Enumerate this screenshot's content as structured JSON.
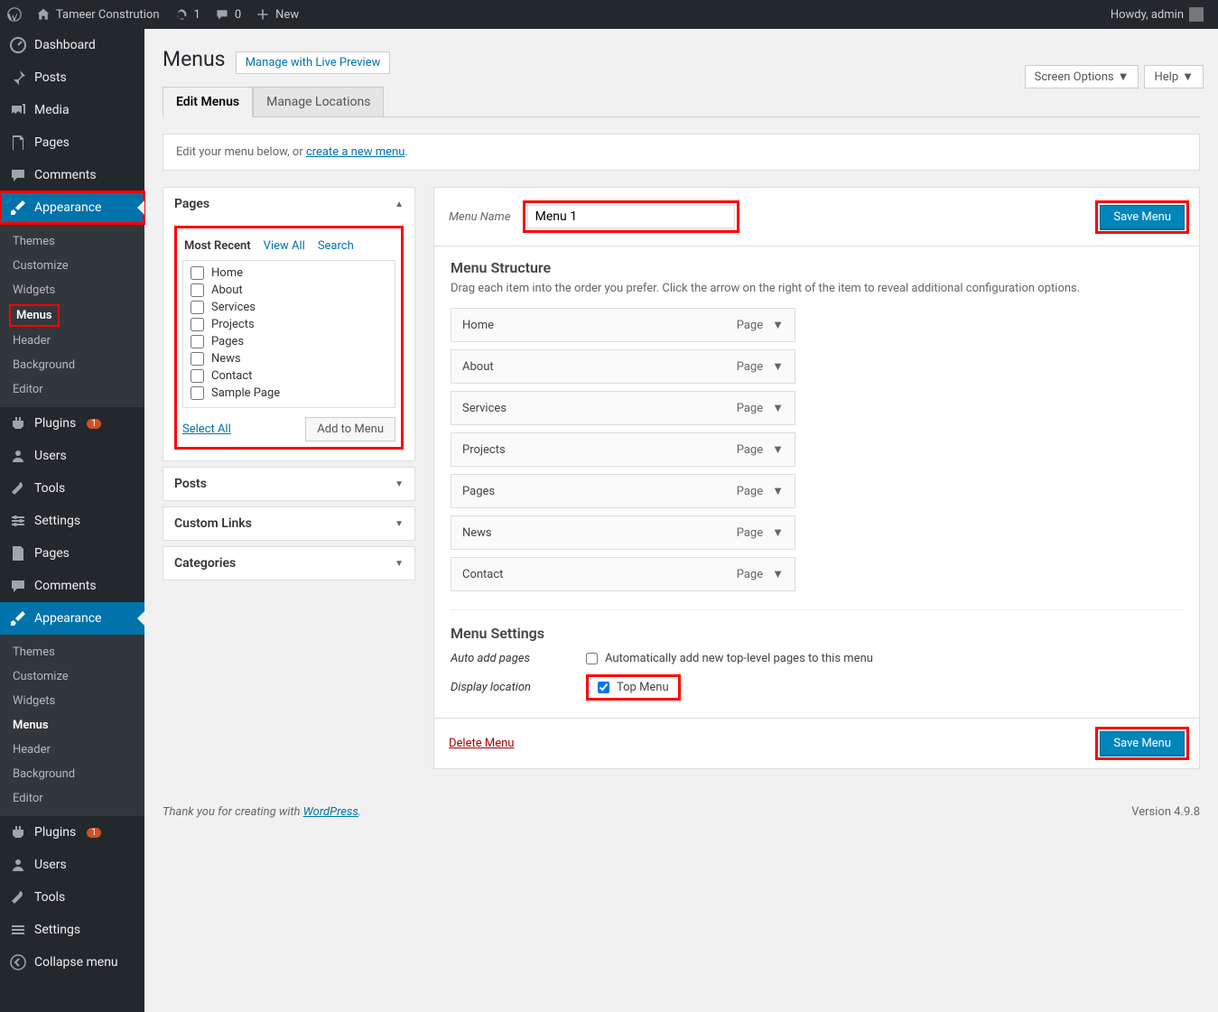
{
  "adminbar": {
    "site": "Tameer Constrution",
    "updates": "1",
    "comments": "0",
    "new": "New",
    "howdy": "Howdy, admin"
  },
  "sidebar": {
    "dashboard": "Dashboard",
    "posts": "Posts",
    "media": "Media",
    "pages": "Pages",
    "comments": "Comments",
    "appearance": "Appearance",
    "appearance_sub": {
      "themes": "Themes",
      "customize": "Customize",
      "widgets": "Widgets",
      "menus": "Menus",
      "header": "Header",
      "background": "Background",
      "editor": "Editor"
    },
    "plugins": "Plugins",
    "plugins_badge": "1",
    "users": "Users",
    "tools": "Tools",
    "settings": "Settings",
    "pages2": "Pages",
    "comments2": "Comments",
    "collapse": "Collapse menu"
  },
  "top": {
    "screen_options": "Screen Options",
    "help": "Help"
  },
  "header": {
    "title": "Menus",
    "live_preview": "Manage with Live Preview"
  },
  "tabs": {
    "edit": "Edit Menus",
    "locations": "Manage Locations"
  },
  "notice": {
    "text": "Edit your menu below, or ",
    "link": "create a new menu"
  },
  "metabox": {
    "pages": "Pages",
    "pages_tabs": {
      "recent": "Most Recent",
      "all": "View All",
      "search": "Search"
    },
    "page_list": [
      "Home",
      "About",
      "Services",
      "Projects",
      "Pages",
      "News",
      "Contact",
      "Sample Page"
    ],
    "select_all": "Select All",
    "add": "Add to Menu",
    "posts": "Posts",
    "custom": "Custom Links",
    "categories": "Categories"
  },
  "menu": {
    "name_label": "Menu Name",
    "name_value": "Menu 1",
    "save": "Save Menu",
    "structure_h": "Menu Structure",
    "structure_p": "Drag each item into the order you prefer. Click the arrow on the right of the item to reveal additional configuration options.",
    "items": [
      {
        "title": "Home",
        "type": "Page"
      },
      {
        "title": "About",
        "type": "Page"
      },
      {
        "title": "Services",
        "type": "Page"
      },
      {
        "title": "Projects",
        "type": "Page"
      },
      {
        "title": "Pages",
        "type": "Page"
      },
      {
        "title": "News",
        "type": "Page"
      },
      {
        "title": "Contact",
        "type": "Page"
      }
    ],
    "settings_h": "Menu Settings",
    "auto_add_l": "Auto add pages",
    "auto_add_r": "Automatically add new top-level pages to this menu",
    "display_l": "Display location",
    "display_r": "Top Menu",
    "delete": "Delete Menu"
  },
  "footer": {
    "thank": "Thank you for creating with ",
    "wp": "WordPress",
    "version": "Version 4.9.8"
  }
}
